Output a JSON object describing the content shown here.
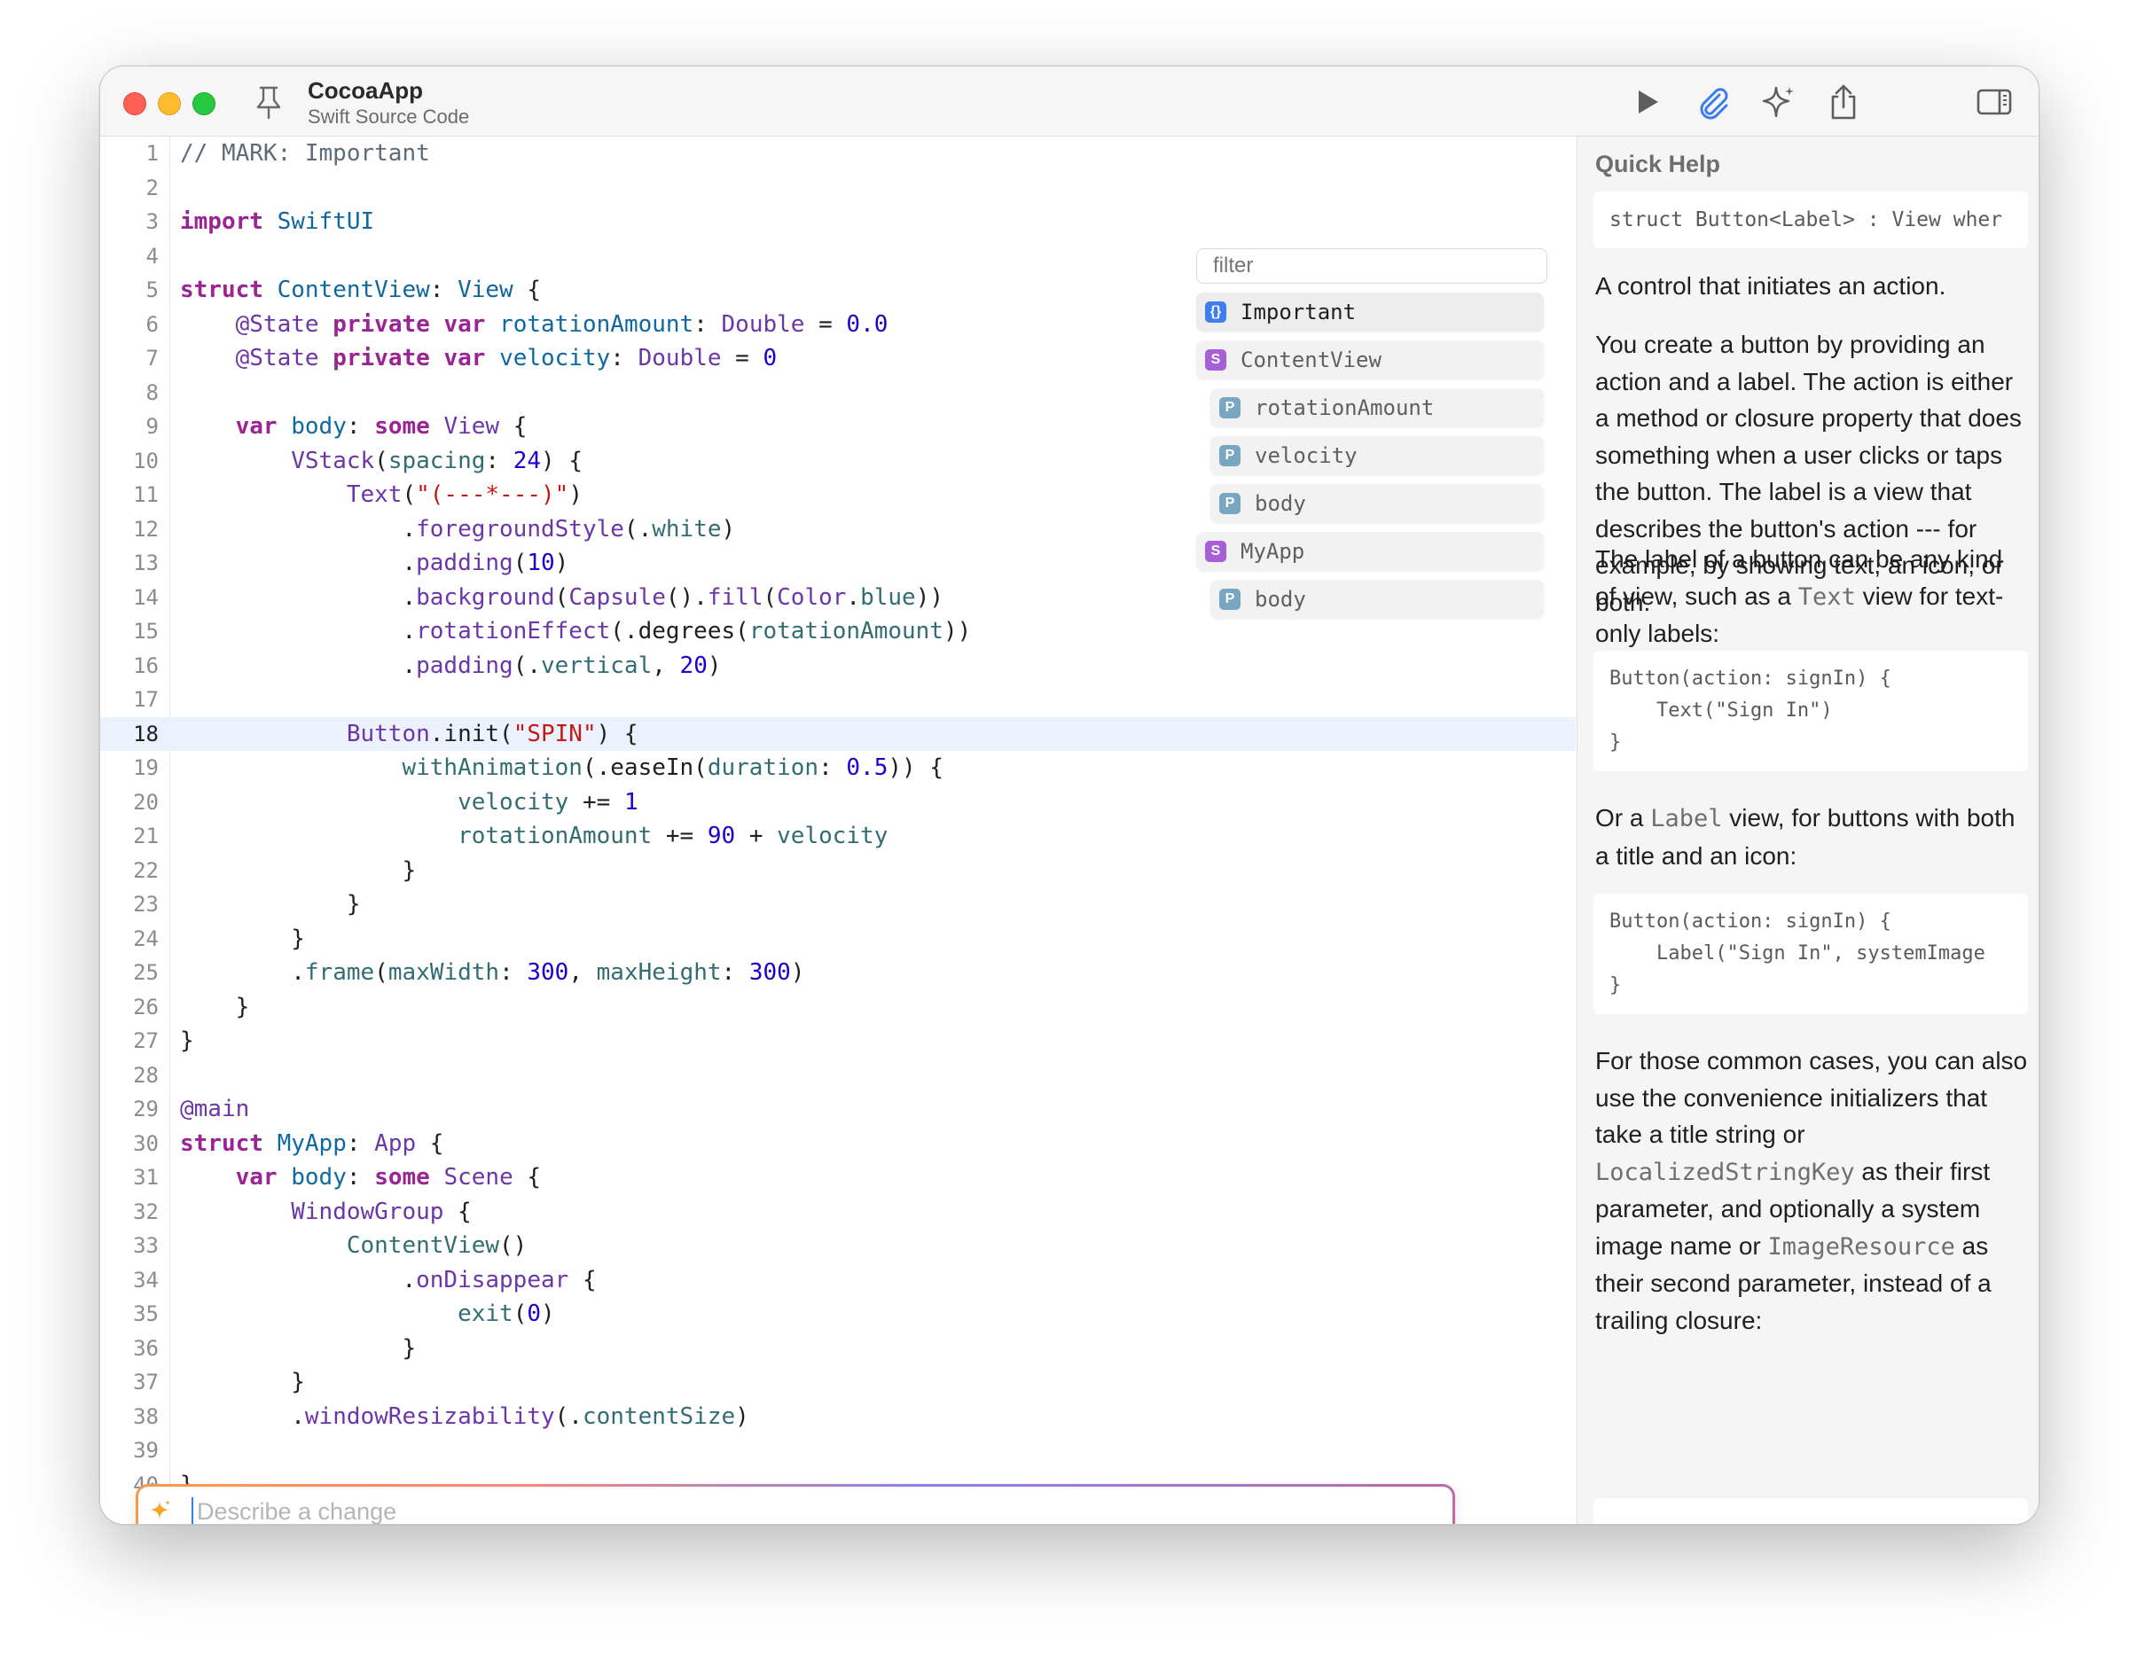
{
  "window": {
    "title": "CocoaApp",
    "subtitle": "Swift Source Code",
    "colors": {
      "close": "#fe5f57",
      "minimize": "#febc2e",
      "maximize": "#28c840",
      "accent": "#3478f6"
    }
  },
  "toolbar": {
    "icons": [
      "pin-icon",
      "run-icon",
      "attach-icon",
      "sparkle-icon",
      "share-icon",
      "sidebar-icon"
    ]
  },
  "editor": {
    "current_line": 18,
    "lines": [
      {
        "n": "1",
        "tokens": [
          [
            "cm",
            "// MARK: Important"
          ]
        ]
      },
      {
        "n": "2",
        "tokens": []
      },
      {
        "n": "3",
        "tokens": [
          [
            "kw",
            "import"
          ],
          [
            "p",
            " "
          ],
          [
            "ty",
            "SwiftUI"
          ]
        ]
      },
      {
        "n": "4",
        "tokens": []
      },
      {
        "n": "5",
        "tokens": [
          [
            "kw",
            "struct"
          ],
          [
            "p",
            " "
          ],
          [
            "ty",
            "ContentView"
          ],
          [
            "p",
            ": "
          ],
          [
            "ty",
            "View"
          ],
          [
            "p",
            " {"
          ]
        ]
      },
      {
        "n": "6",
        "tokens": [
          [
            "p",
            "    "
          ],
          [
            "pr",
            "@State"
          ],
          [
            "p",
            " "
          ],
          [
            "kw",
            "private"
          ],
          [
            "p",
            " "
          ],
          [
            "kw",
            "var"
          ],
          [
            "p",
            " "
          ],
          [
            "ty",
            "rotationAmount"
          ],
          [
            "p",
            ": "
          ],
          [
            "pr",
            "Double"
          ],
          [
            "p",
            " = "
          ],
          [
            "num",
            "0.0"
          ]
        ]
      },
      {
        "n": "7",
        "tokens": [
          [
            "p",
            "    "
          ],
          [
            "pr",
            "@State"
          ],
          [
            "p",
            " "
          ],
          [
            "kw",
            "private"
          ],
          [
            "p",
            " "
          ],
          [
            "kw",
            "var"
          ],
          [
            "p",
            " "
          ],
          [
            "ty",
            "velocity"
          ],
          [
            "p",
            ": "
          ],
          [
            "pr",
            "Double"
          ],
          [
            "p",
            " = "
          ],
          [
            "num",
            "0"
          ]
        ]
      },
      {
        "n": "8",
        "tokens": []
      },
      {
        "n": "9",
        "tokens": [
          [
            "p",
            "    "
          ],
          [
            "kw",
            "var"
          ],
          [
            "p",
            " "
          ],
          [
            "ty",
            "body"
          ],
          [
            "p",
            ": "
          ],
          [
            "kw",
            "some"
          ],
          [
            "p",
            " "
          ],
          [
            "pr",
            "View"
          ],
          [
            "p",
            " {"
          ]
        ]
      },
      {
        "n": "10",
        "tokens": [
          [
            "p",
            "        "
          ],
          [
            "pr",
            "VStack"
          ],
          [
            "p",
            "("
          ],
          [
            "fn",
            "spacing"
          ],
          [
            "p",
            ": "
          ],
          [
            "num",
            "24"
          ],
          [
            "p",
            ") {"
          ]
        ]
      },
      {
        "n": "11",
        "tokens": [
          [
            "p",
            "            "
          ],
          [
            "pr",
            "Text"
          ],
          [
            "p",
            "("
          ],
          [
            "str",
            "\"(---*---)\""
          ],
          [
            "p",
            ")"
          ]
        ]
      },
      {
        "n": "12",
        "tokens": [
          [
            "p",
            "                ."
          ],
          [
            "pr",
            "foregroundStyle"
          ],
          [
            "p",
            "(."
          ],
          [
            "fn",
            "white"
          ],
          [
            "p",
            ")"
          ]
        ]
      },
      {
        "n": "13",
        "tokens": [
          [
            "p",
            "                ."
          ],
          [
            "pr",
            "padding"
          ],
          [
            "p",
            "("
          ],
          [
            "num",
            "10"
          ],
          [
            "p",
            ")"
          ]
        ]
      },
      {
        "n": "14",
        "tokens": [
          [
            "p",
            "                ."
          ],
          [
            "pr",
            "background"
          ],
          [
            "p",
            "("
          ],
          [
            "pr",
            "Capsule"
          ],
          [
            "p",
            "()."
          ],
          [
            "pr",
            "fill"
          ],
          [
            "p",
            "("
          ],
          [
            "pr",
            "Color"
          ],
          [
            "p",
            "."
          ],
          [
            "fn",
            "blue"
          ],
          [
            "p",
            "))"
          ]
        ]
      },
      {
        "n": "15",
        "tokens": [
          [
            "p",
            "                ."
          ],
          [
            "pr",
            "rotationEffect"
          ],
          [
            "p",
            "(.degrees("
          ],
          [
            "fn",
            "rotationAmount"
          ],
          [
            "p",
            "))"
          ]
        ]
      },
      {
        "n": "16",
        "tokens": [
          [
            "p",
            "                ."
          ],
          [
            "pr",
            "padding"
          ],
          [
            "p",
            "(."
          ],
          [
            "fn",
            "vertical"
          ],
          [
            "p",
            ", "
          ],
          [
            "num",
            "20"
          ],
          [
            "p",
            ")"
          ]
        ]
      },
      {
        "n": "17",
        "tokens": []
      },
      {
        "n": "18",
        "tokens": [
          [
            "p",
            "            "
          ],
          [
            "pr",
            "Button"
          ],
          [
            "p",
            ".init("
          ],
          [
            "str",
            "\"SPIN\""
          ],
          [
            "p",
            ") {"
          ]
        ]
      },
      {
        "n": "19",
        "tokens": [
          [
            "p",
            "                "
          ],
          [
            "fn",
            "withAnimation"
          ],
          [
            "p",
            "(.easeIn("
          ],
          [
            "fn",
            "duration"
          ],
          [
            "p",
            ": "
          ],
          [
            "num",
            "0.5"
          ],
          [
            "p",
            ")) {"
          ]
        ]
      },
      {
        "n": "20",
        "tokens": [
          [
            "p",
            "                    "
          ],
          [
            "fn",
            "velocity"
          ],
          [
            "p",
            " += "
          ],
          [
            "num",
            "1"
          ]
        ]
      },
      {
        "n": "21",
        "tokens": [
          [
            "p",
            "                    "
          ],
          [
            "fn",
            "rotationAmount"
          ],
          [
            "p",
            " += "
          ],
          [
            "num",
            "90"
          ],
          [
            "p",
            " + "
          ],
          [
            "fn",
            "velocity"
          ]
        ]
      },
      {
        "n": "22",
        "tokens": [
          [
            "p",
            "                }"
          ]
        ]
      },
      {
        "n": "23",
        "tokens": [
          [
            "p",
            "            }"
          ]
        ]
      },
      {
        "n": "24",
        "tokens": [
          [
            "p",
            "        }"
          ]
        ]
      },
      {
        "n": "25",
        "tokens": [
          [
            "p",
            "        ."
          ],
          [
            "fn",
            "frame"
          ],
          [
            "p",
            "("
          ],
          [
            "fn",
            "maxWidth"
          ],
          [
            "p",
            ": "
          ],
          [
            "num",
            "300"
          ],
          [
            "p",
            ", "
          ],
          [
            "fn",
            "maxHeight"
          ],
          [
            "p",
            ": "
          ],
          [
            "num",
            "300"
          ],
          [
            "p",
            ")"
          ]
        ]
      },
      {
        "n": "26",
        "tokens": [
          [
            "p",
            "    }"
          ]
        ]
      },
      {
        "n": "27",
        "tokens": [
          [
            "p",
            "}"
          ]
        ]
      },
      {
        "n": "28",
        "tokens": []
      },
      {
        "n": "29",
        "tokens": [
          [
            "pr",
            "@main"
          ]
        ]
      },
      {
        "n": "30",
        "tokens": [
          [
            "kw",
            "struct"
          ],
          [
            "p",
            " "
          ],
          [
            "ty",
            "MyApp"
          ],
          [
            "p",
            ": "
          ],
          [
            "pr",
            "App"
          ],
          [
            "p",
            " {"
          ]
        ]
      },
      {
        "n": "31",
        "tokens": [
          [
            "p",
            "    "
          ],
          [
            "kw",
            "var"
          ],
          [
            "p",
            " "
          ],
          [
            "ty",
            "body"
          ],
          [
            "p",
            ": "
          ],
          [
            "kw",
            "some"
          ],
          [
            "p",
            " "
          ],
          [
            "pr",
            "Scene"
          ],
          [
            "p",
            " {"
          ]
        ]
      },
      {
        "n": "32",
        "tokens": [
          [
            "p",
            "        "
          ],
          [
            "pr",
            "WindowGroup"
          ],
          [
            "p",
            " {"
          ]
        ]
      },
      {
        "n": "33",
        "tokens": [
          [
            "p",
            "            "
          ],
          [
            "fn",
            "ContentView"
          ],
          [
            "p",
            "()"
          ]
        ]
      },
      {
        "n": "34",
        "tokens": [
          [
            "p",
            "                ."
          ],
          [
            "pr",
            "onDisappear"
          ],
          [
            "p",
            " {"
          ]
        ]
      },
      {
        "n": "35",
        "tokens": [
          [
            "p",
            "                    "
          ],
          [
            "fn",
            "exit"
          ],
          [
            "p",
            "("
          ],
          [
            "num",
            "0"
          ],
          [
            "p",
            ")"
          ]
        ]
      },
      {
        "n": "36",
        "tokens": [
          [
            "p",
            "                }"
          ]
        ]
      },
      {
        "n": "37",
        "tokens": [
          [
            "p",
            "        }"
          ]
        ]
      },
      {
        "n": "38",
        "tokens": [
          [
            "p",
            "        ."
          ],
          [
            "pr",
            "windowResizability"
          ],
          [
            "p",
            "(."
          ],
          [
            "fn",
            "contentSize"
          ],
          [
            "p",
            ")"
          ]
        ]
      },
      {
        "n": "39",
        "tokens": []
      },
      {
        "n": "40",
        "tokens": [
          [
            "p",
            "}"
          ]
        ]
      }
    ]
  },
  "outline": {
    "filter_placeholder": "filter",
    "items": [
      {
        "badge": "{}",
        "badge_color": "#3f7df6",
        "label": "Important",
        "level": 1,
        "selected": true
      },
      {
        "badge": "S",
        "badge_color": "#a65fd6",
        "label": "ContentView",
        "level": 1
      },
      {
        "badge": "P",
        "badge_color": "#79a6c1",
        "label": "rotationAmount",
        "level": 2
      },
      {
        "badge": "P",
        "badge_color": "#79a6c1",
        "label": "velocity",
        "level": 2
      },
      {
        "badge": "P",
        "badge_color": "#79a6c1",
        "label": "body",
        "level": 2
      },
      {
        "badge": "S",
        "badge_color": "#a65fd6",
        "label": "MyApp",
        "level": 1
      },
      {
        "badge": "P",
        "badge_color": "#79a6c1",
        "label": "body",
        "level": 2
      }
    ]
  },
  "prompt": {
    "placeholder": "Describe a change",
    "value": ""
  },
  "quick_help": {
    "title": "Quick Help",
    "declaration": "struct Button<Label> : View wher",
    "summary": "A control that initiates an action.",
    "p1": "You create a button by providing an action and a label. The action is either a method or closure property that does something when a user clicks or taps the button. The label is a view that describes the button's action --- for example, by showing text, an icon, or both.",
    "p2_a": "The label of a button can be any kind of view, such as a ",
    "p2_code": "Text",
    "p2_b": " view for text-only labels:",
    "code1": "Button(action: signIn) {\n    Text(\"Sign In\")\n}",
    "p3_a": "Or a ",
    "p3_code": "Label",
    "p3_b": " view, for buttons with both a title and an icon:",
    "code2": "Button(action: signIn) {\n    Label(\"Sign In\", systemImage\n}",
    "p4_a": "For those common cases, you can also use the convenience initializers that take a title string or ",
    "p4_code1": "LocalizedStringKey",
    "p4_b": " as their first parameter, and optionally a system image name or ",
    "p4_code2": "ImageResource",
    "p4_c": " as their second parameter, instead of a trailing closure:"
  }
}
